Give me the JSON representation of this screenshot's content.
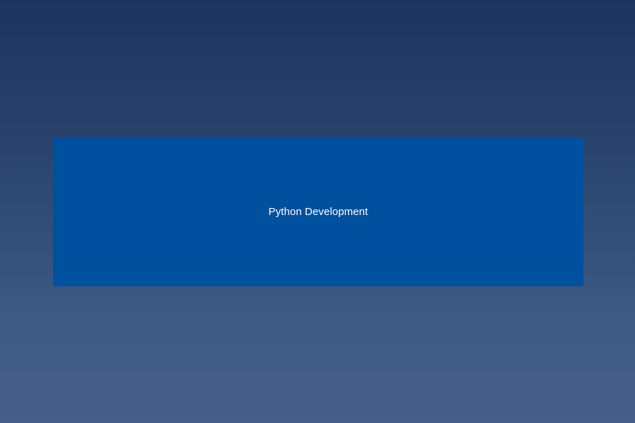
{
  "banner": {
    "label": "Python Development",
    "background_color": "#0050a0",
    "text_color": "#ffffff"
  },
  "page": {
    "gradient_top_color": "#1c3560",
    "gradient_bottom_color": "#465f88"
  }
}
